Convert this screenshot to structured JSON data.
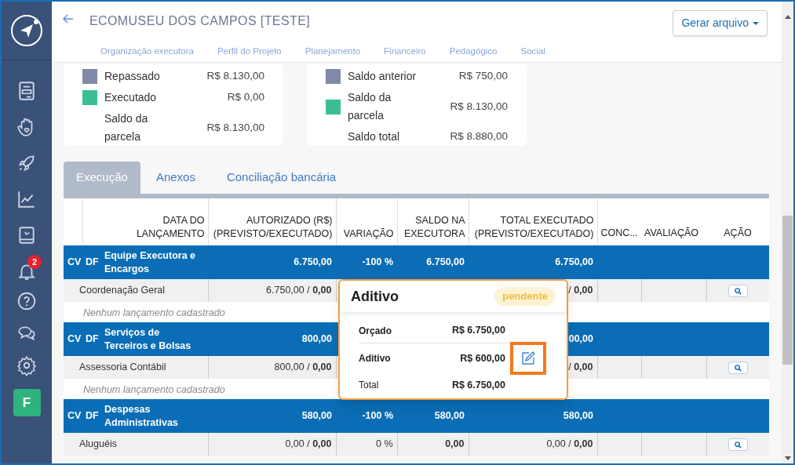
{
  "sidebar": {
    "notification_count": "2",
    "avatar": "F"
  },
  "header": {
    "title": "ECOMUSEU DOS CAMPOS [TESTE]",
    "generate_button": "Gerar arquivo",
    "nav": [
      "Organização executora",
      "Perfil do Projeto",
      "Planejamento",
      "Financeiro",
      "Pedagógico",
      "Social"
    ]
  },
  "summary_cards": [
    {
      "rows": [
        {
          "label": "Repassado",
          "value": "R$ 8.130,00",
          "color": "#7f8ba6"
        },
        {
          "label": "Executado",
          "value": "R$ 0,00",
          "color": "#3bbf92"
        },
        {
          "label": "Saldo da parcela",
          "value": "R$ 8.130,00"
        }
      ]
    },
    {
      "rows": [
        {
          "label": "Saldo anterior",
          "value": "R$ 750,00",
          "color": "#7f8ba6"
        },
        {
          "label": "Saldo da parcela",
          "value": "R$ 8.130,00",
          "color": "#3bbf92"
        },
        {
          "label": "Saldo total",
          "value": "R$ 8.880,00"
        }
      ]
    }
  ],
  "tabs": [
    {
      "label": "Execução",
      "selected": true
    },
    {
      "label": "Anexos",
      "selected": false
    },
    {
      "label": "Conciliação bancária",
      "selected": false
    }
  ],
  "table": {
    "columns": [
      "DATA DO LANÇAMENTO",
      "AUTORIZADO (R$) (PREVISTO/EXECUTADO)",
      "VARIAÇÃO",
      "SALDO NA EXECUTORA",
      "TOTAL EXECUTADO (PREVISTO/EXECUTADO)",
      "CONC...",
      "AVALIAÇÃO",
      "AÇÃO"
    ],
    "rows": [
      {
        "kind": "group",
        "cv": "CV",
        "df": "DF",
        "name": "Equipe Executora e Encargos",
        "authorized": "6.750,00",
        "variation": "-100 %",
        "balance": "6.750,00",
        "total": "6.750,00"
      },
      {
        "kind": "item",
        "name": "Coordenação Geral",
        "authorized": "6.750,00 / **0,00**",
        "total": "/ **0,00**"
      },
      {
        "kind": "empty",
        "text": "Nenhum lançamento cadastrado"
      },
      {
        "kind": "group",
        "cv": "CV",
        "df": "DF",
        "name": "Serviços de Terceiros e Bolsas",
        "authorized": "800,00",
        "total": "00,00"
      },
      {
        "kind": "item",
        "name": "Assessoria Contábil",
        "authorized": "800,00 / **0,00**",
        "total": "/ **0,00**"
      },
      {
        "kind": "empty",
        "text": "Nenhum lançamento cadastrado"
      },
      {
        "kind": "group",
        "cv": "CV",
        "df": "DF",
        "name": "Despesas Administrativas",
        "authorized": "580,00",
        "variation": "-100 %",
        "balance": "580,00",
        "total": "580,00"
      },
      {
        "kind": "item",
        "name": "Aluguéis",
        "authorized": "0,00 / **0,00**",
        "variation": "0 %",
        "balance": "0,00",
        "total": "0,00 / **0,00**"
      }
    ]
  },
  "popover": {
    "title": "Aditivo",
    "status": "pendente",
    "rows": [
      {
        "label": "Orçado",
        "value": "R$ 6.750,00",
        "bold": true,
        "editable": false
      },
      {
        "label": "Aditivo",
        "value": "R$ 600,00",
        "bold": true,
        "editable": true
      },
      {
        "label": "Total",
        "value": "R$ 6.750,00",
        "bold": false,
        "editable": false
      }
    ]
  }
}
